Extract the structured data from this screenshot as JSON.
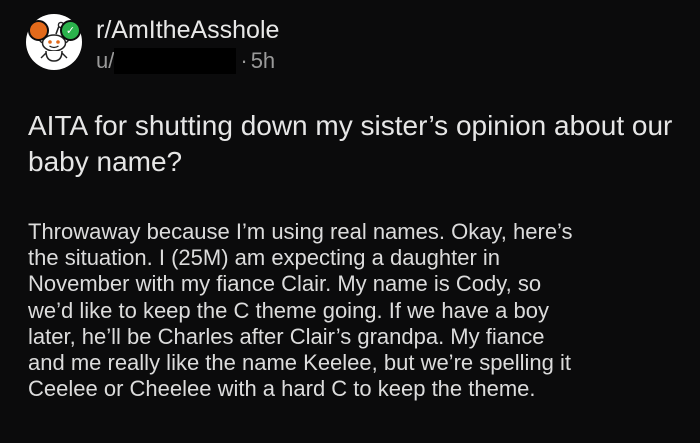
{
  "post": {
    "subreddit": "r/AmItheAsshole",
    "user_prefix": "u/",
    "separator": "·",
    "time": "5h",
    "title": "AITA for shutting down my sister’s opinion about our baby name?",
    "body_lines": [
      "Throwaway because I’m using real names. Okay, here’s",
      "the situation. I (25M) am expecting a daughter in",
      "November with my fiance Clair. My name is Cody, so",
      "we’d like to keep the C theme going. If we have a boy",
      "later, he’ll be Charles after Clair’s grandpa. My fiance",
      "and me really like the name Keelee, but we’re spelling it",
      "Ceelee or Cheelee with a hard C to keep the theme."
    ]
  },
  "icons": {
    "avatar": "reddit-snoo-avatar-icon",
    "badge_left": "award-badge-icon",
    "badge_right": "verified-check-icon"
  },
  "colors": {
    "background": "#0b0b0c",
    "text": "#dcdcdc",
    "muted": "#9a9a9a",
    "badge_orange": "#e36a1b",
    "badge_green": "#2bb24c"
  }
}
